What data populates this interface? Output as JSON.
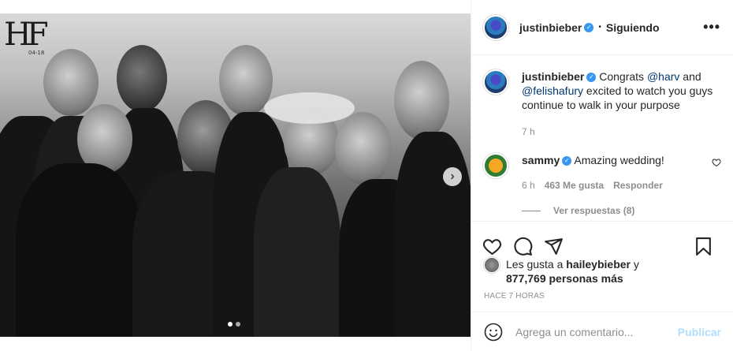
{
  "photo": {
    "monogram": "HF",
    "monogram_date": "04-18",
    "carousel": {
      "count": 2,
      "active": 1
    },
    "next_glyph": "›"
  },
  "header": {
    "username": "justinbieber",
    "verified": true,
    "separator": "•",
    "follow_status": "Siguiendo",
    "more_glyph": "•••"
  },
  "comments": {
    "caption": {
      "username": "justinbieber",
      "text_before": " Congrats ",
      "mention1": "@harv",
      "text_mid": " and ",
      "mention2": "@felishafury",
      "text_after": " excited to watch you guys continue to walk in your purpose",
      "time": "7 h"
    },
    "items": [
      {
        "username": "sammy",
        "text": "Amazing wedding!",
        "time": "6 h",
        "likes": "463 Me gusta",
        "reply_label": "Responder",
        "view_replies": "Ver respuestas (8)"
      }
    ]
  },
  "actions": {
    "like_icon": "heart-outline",
    "comment_icon": "speech-bubble",
    "share_icon": "paper-plane",
    "save_icon": "bookmark"
  },
  "likes": {
    "prefix": "Les gusta a ",
    "user": "haileybieber",
    "suffix": " y",
    "count": "877,769 personas más"
  },
  "time_ago": "HACE 7 HORAS",
  "add_comment": {
    "placeholder": "Agrega un comentario...",
    "publish_label": "Publicar"
  },
  "colors": {
    "verified": "#3897f0",
    "link": "#00376b",
    "muted": "#8e8e8e",
    "publish_disabled": "#b2dffc"
  }
}
